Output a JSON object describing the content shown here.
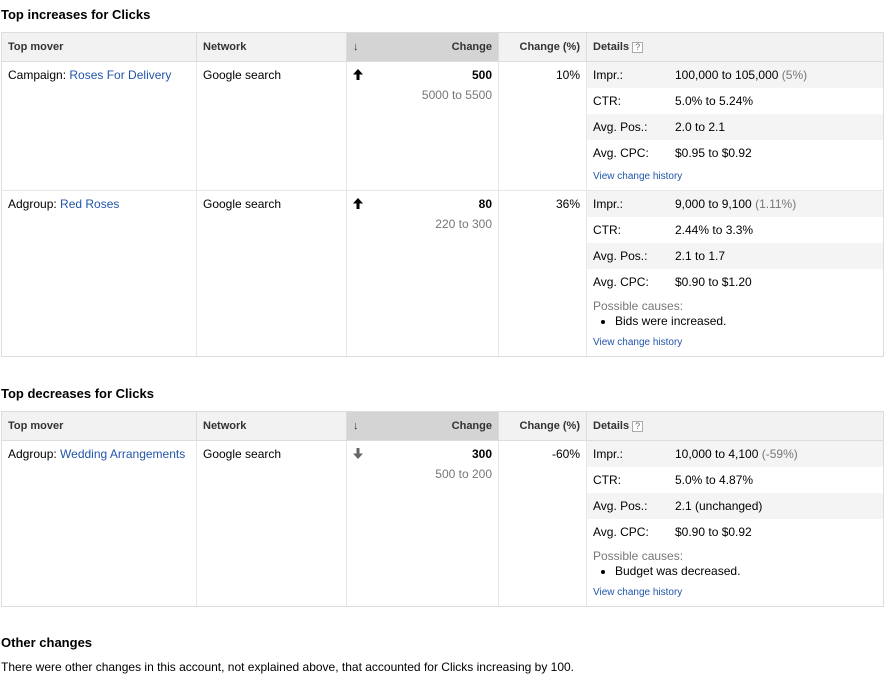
{
  "increases": {
    "title": "Top increases for Clicks",
    "headers": {
      "mover": "Top mover",
      "network": "Network",
      "sort_icon": "↓",
      "change": "Change",
      "pct": "Change (%)",
      "details": "Details",
      "help": "?"
    },
    "rows": [
      {
        "type_label": "Campaign: ",
        "name": "Roses For Delivery",
        "network": "Google search",
        "direction": "up-arrow-icon",
        "change": "500",
        "range": "5000 to 5500",
        "pct": "10%",
        "metrics": [
          {
            "label": "Impr.:",
            "value": "100,000 to 105,000",
            "extra": " (5%)"
          },
          {
            "label": "CTR:",
            "value": "5.0% to 5.24%",
            "extra": ""
          },
          {
            "label": "Avg. Pos.:",
            "value": "2.0 to 2.1",
            "extra": ""
          },
          {
            "label": "Avg. CPC:",
            "value": "$0.95 to $0.92",
            "extra": ""
          }
        ],
        "causes_label": "",
        "causes": [],
        "history_link": "View change history"
      },
      {
        "type_label": "Adgroup: ",
        "name": "Red Roses",
        "network": "Google search",
        "direction": "up-arrow-icon",
        "change": "80",
        "range": "220 to 300",
        "pct": "36%",
        "metrics": [
          {
            "label": "Impr.:",
            "value": "9,000 to 9,100",
            "extra": " (1.11%)"
          },
          {
            "label": "CTR:",
            "value": "2.44% to 3.3%",
            "extra": ""
          },
          {
            "label": "Avg. Pos.:",
            "value": "2.1 to 1.7",
            "extra": ""
          },
          {
            "label": "Avg. CPC:",
            "value": "$0.90 to $1.20",
            "extra": ""
          }
        ],
        "causes_label": "Possible causes:",
        "causes": [
          "Bids were increased."
        ],
        "history_link": "View change history"
      }
    ]
  },
  "decreases": {
    "title": "Top decreases for Clicks",
    "headers": {
      "mover": "Top mover",
      "network": "Network",
      "sort_icon": "↓",
      "change": "Change",
      "pct": "Change (%)",
      "details": "Details",
      "help": "?"
    },
    "rows": [
      {
        "type_label": "Adgroup: ",
        "name": "Wedding Arrangements",
        "network": "Google search",
        "direction": "down-arrow-icon",
        "change": "300",
        "range": "500 to 200",
        "pct": "-60%",
        "metrics": [
          {
            "label": "Impr.:",
            "value": "10,000 to 4,100",
            "extra": " (-59%)"
          },
          {
            "label": "CTR:",
            "value": "5.0% to 4.87%",
            "extra": ""
          },
          {
            "label": "Avg. Pos.:",
            "value": "2.1 (unchanged)",
            "extra": ""
          },
          {
            "label": "Avg. CPC:",
            "value": "$0.90 to $0.92",
            "extra": ""
          }
        ],
        "causes_label": "Possible causes:",
        "causes": [
          "Budget was decreased."
        ],
        "history_link": "View change history"
      }
    ]
  },
  "other": {
    "title": "Other changes",
    "text": "There were other changes in this account, not explained above, that accounted for Clicks increasing by 100."
  }
}
